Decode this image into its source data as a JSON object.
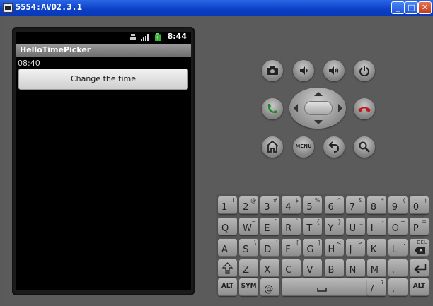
{
  "window": {
    "title": "5554:AVD2.3.1",
    "minimize": "_",
    "maximize": "□",
    "close": "✕"
  },
  "status": {
    "time": "8:44"
  },
  "app": {
    "title": "HelloTimePicker",
    "time_value": "08:40",
    "button_label": "Change the time"
  },
  "controls": {
    "menu_label": "MENU"
  },
  "keyboard": {
    "row1": [
      {
        "main": "1",
        "sub": "!"
      },
      {
        "main": "2",
        "sub": "@"
      },
      {
        "main": "3",
        "sub": "#"
      },
      {
        "main": "4",
        "sub": "$"
      },
      {
        "main": "5",
        "sub": "%"
      },
      {
        "main": "6",
        "sub": "^"
      },
      {
        "main": "7",
        "sub": "&"
      },
      {
        "main": "8",
        "sub": "*"
      },
      {
        "main": "9",
        "sub": "("
      },
      {
        "main": "0",
        "sub": ")"
      }
    ],
    "row2": [
      {
        "main": "Q",
        "sub": ""
      },
      {
        "main": "W",
        "sub": "~"
      },
      {
        "main": "E",
        "sub": "\""
      },
      {
        "main": "R",
        "sub": "`"
      },
      {
        "main": "T",
        "sub": "{"
      },
      {
        "main": "Y",
        "sub": "}"
      },
      {
        "main": "U",
        "sub": "_"
      },
      {
        "main": "I",
        "sub": "-"
      },
      {
        "main": "O",
        "sub": "+"
      },
      {
        "main": "P",
        "sub": "="
      }
    ],
    "row3": [
      {
        "main": "A",
        "sub": ""
      },
      {
        "main": "S",
        "sub": "\\"
      },
      {
        "main": "D",
        "sub": "'"
      },
      {
        "main": "F",
        "sub": "["
      },
      {
        "main": "G",
        "sub": "]"
      },
      {
        "main": "H",
        "sub": "<"
      },
      {
        "main": "J",
        "sub": ">"
      },
      {
        "main": "K",
        "sub": ";"
      },
      {
        "main": "L",
        "sub": ":"
      }
    ],
    "del_label": "DEL",
    "row4": [
      {
        "main": "Z",
        "sub": ""
      },
      {
        "main": "X",
        "sub": ""
      },
      {
        "main": "C",
        "sub": ""
      },
      {
        "main": "V",
        "sub": ""
      },
      {
        "main": "B",
        "sub": ""
      },
      {
        "main": "N",
        "sub": ""
      },
      {
        "main": "M",
        "sub": ""
      },
      {
        "main": ".",
        "sub": ""
      }
    ],
    "alt_label": "ALT",
    "sym_label": "SYM",
    "at_label": "@",
    "slash_main": "/",
    "slash_sub": "?",
    "comma_main": ",",
    "comma_sub": ""
  }
}
